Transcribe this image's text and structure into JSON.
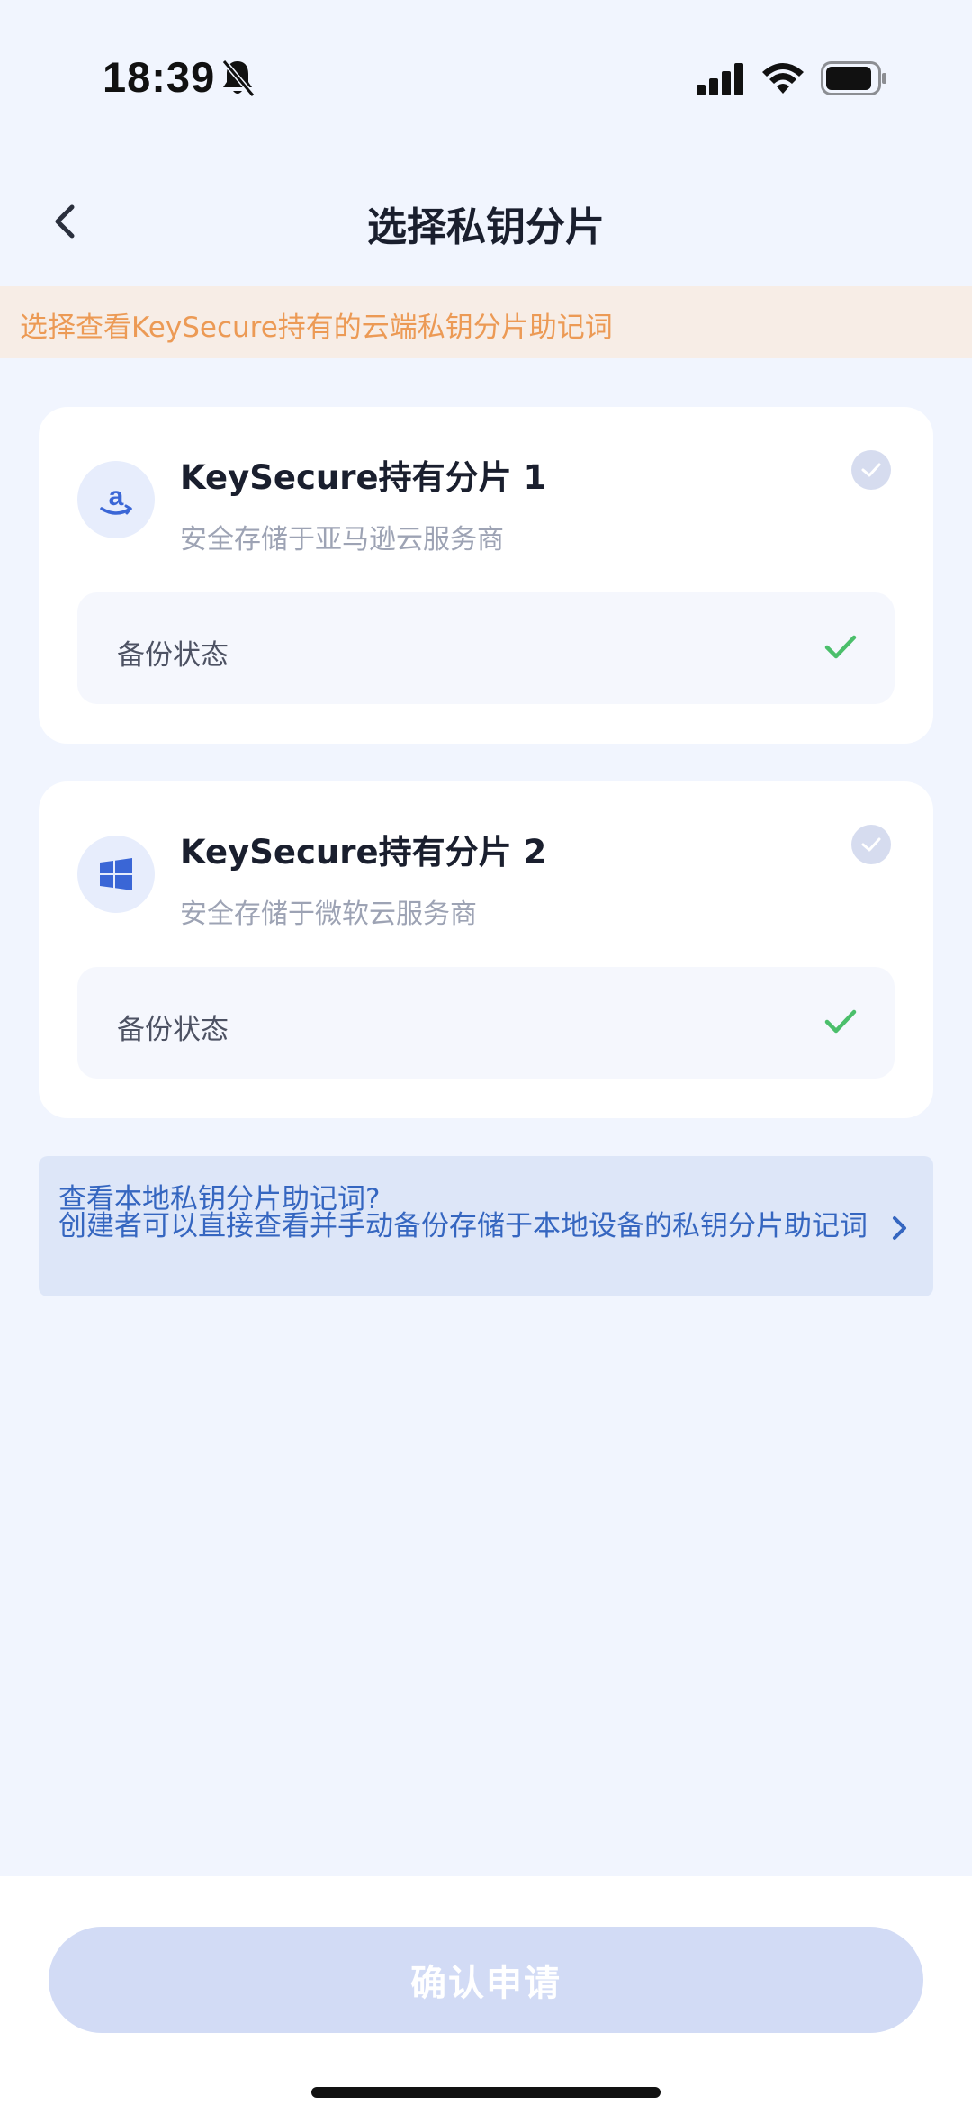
{
  "status_bar": {
    "time": "18:39"
  },
  "nav": {
    "title": "选择私钥分片"
  },
  "notice": {
    "text": "选择查看KeySecure持有的云端私钥分片助记词"
  },
  "shards": [
    {
      "title": "KeySecure持有分片 1",
      "subtitle": "安全存储于亚马逊云服务商",
      "status_label": "备份状态",
      "icon": "amazon-icon"
    },
    {
      "title": "KeySecure持有分片 2",
      "subtitle": "安全存储于微软云服务商",
      "status_label": "备份状态",
      "icon": "windows-icon"
    }
  ],
  "local_info": {
    "question": "查看本地私钥分片助记词?",
    "description": "创建者可以直接查看并手动备份存储于本地设备的私钥分片助记词"
  },
  "footer": {
    "confirm_label": "确认申请"
  },
  "colors": {
    "accent": "#3566c0",
    "notice_text": "#ec9a55",
    "check_green": "#4bbf6b",
    "button_disabled": "#d2dbf5"
  }
}
